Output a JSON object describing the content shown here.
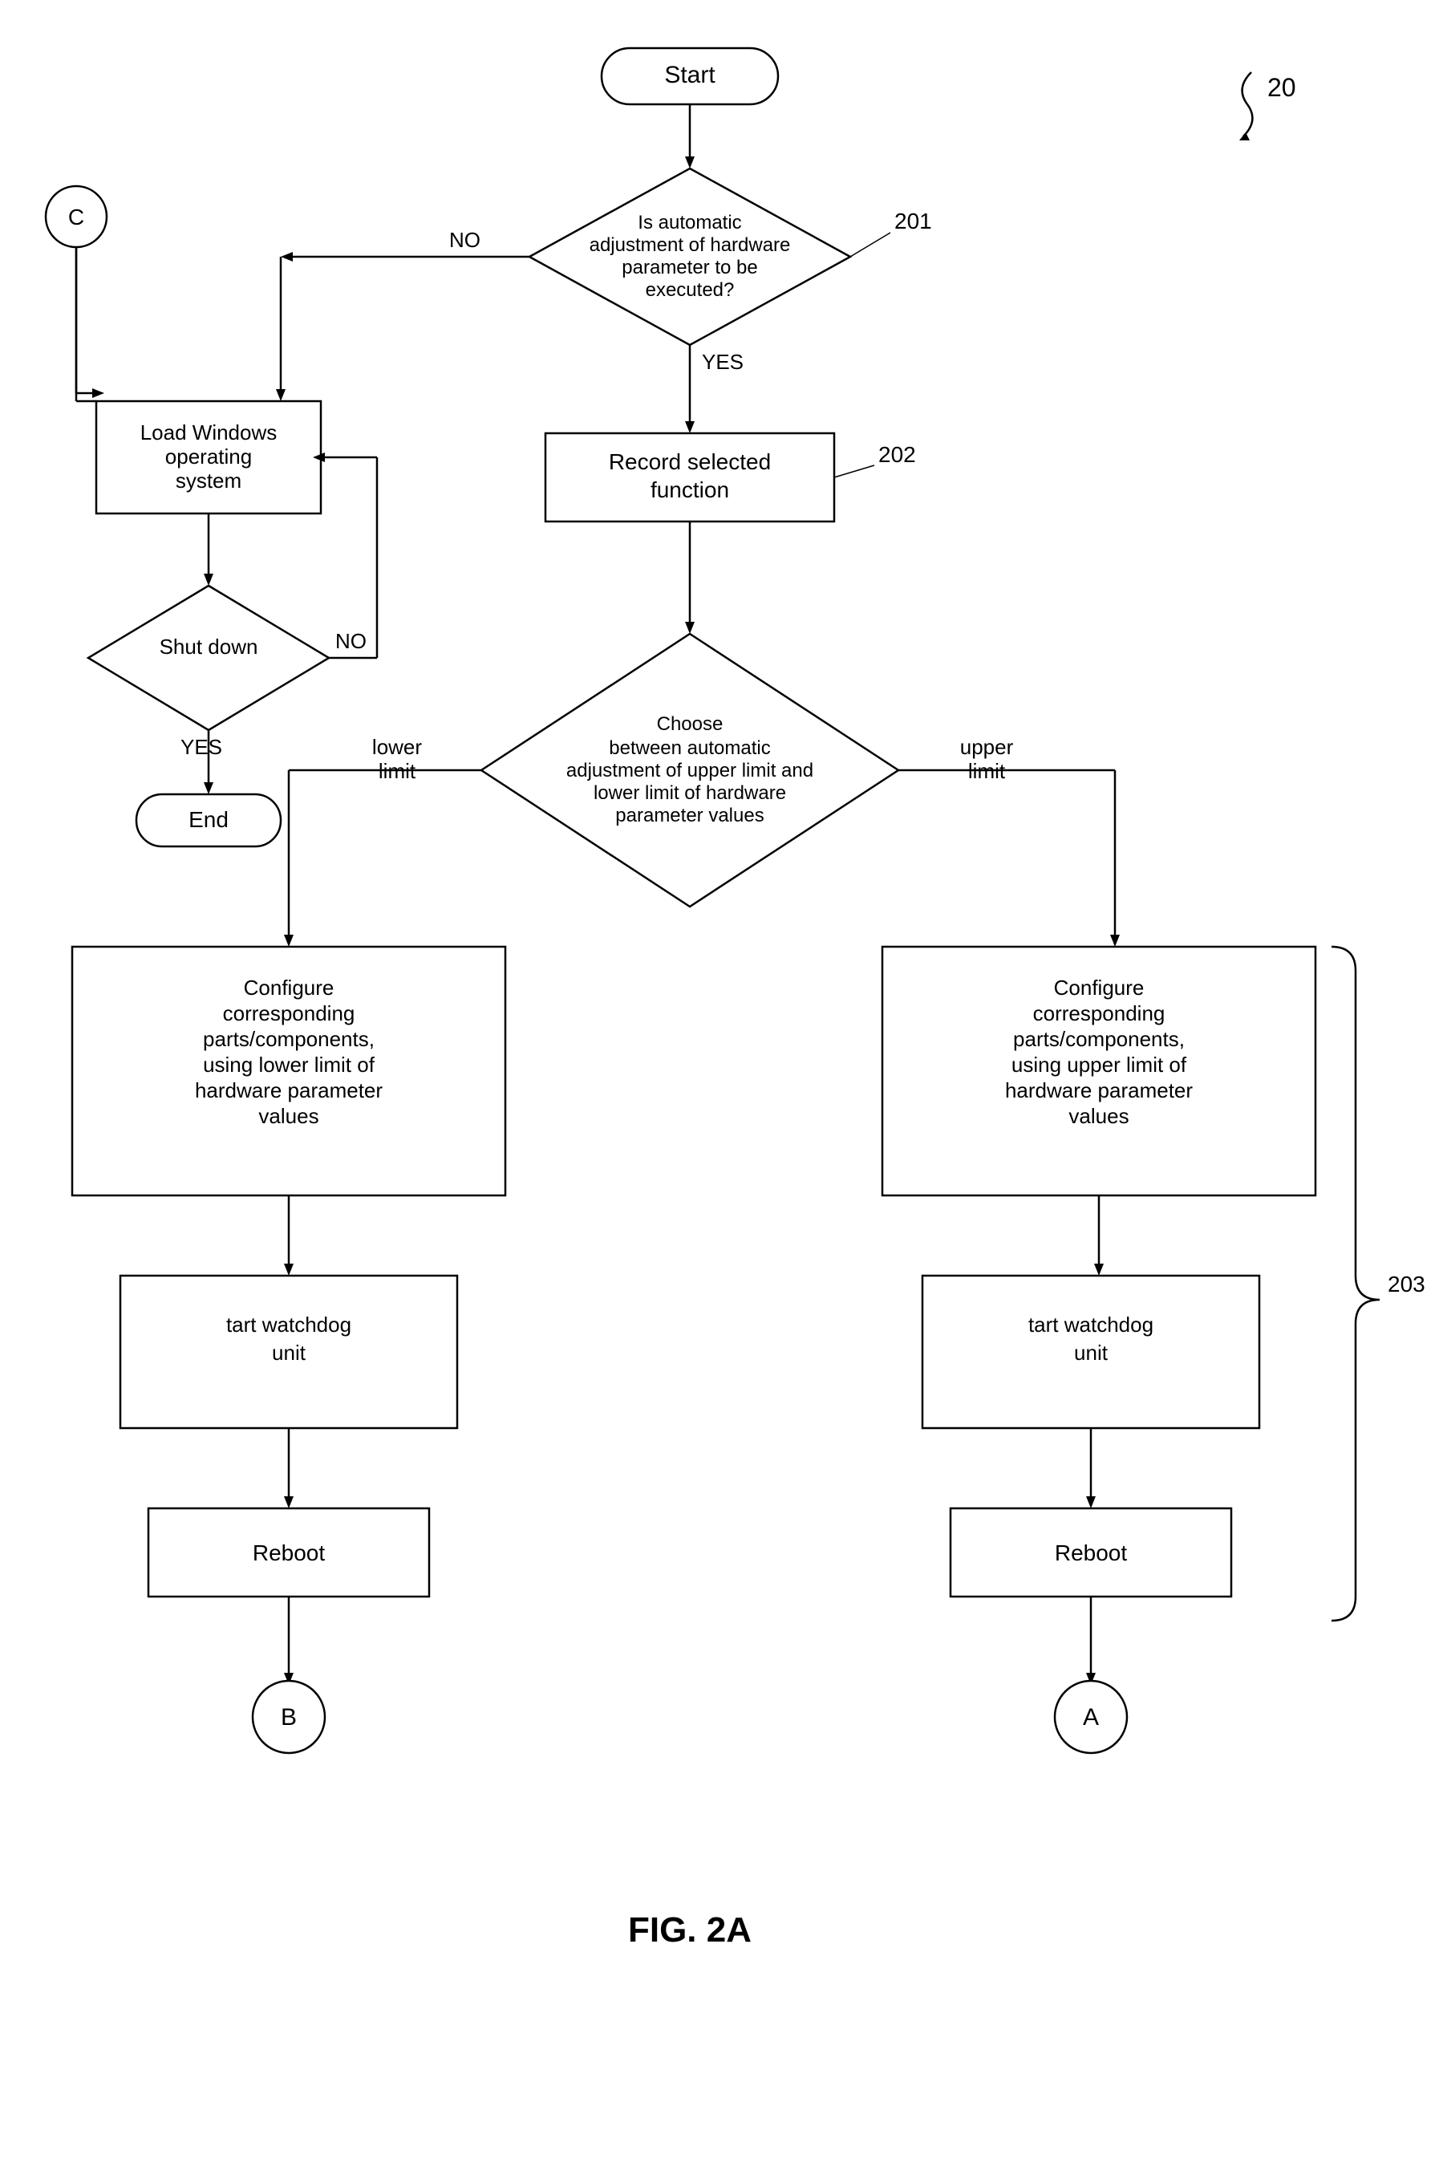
{
  "title": "FIG. 2A",
  "figure_number": "20",
  "nodes": {
    "start": {
      "label": "Start"
    },
    "decision1": {
      "label": "Is automatic\nadjustment of hardware\nparameter to be\nexecuted?",
      "ref": "201"
    },
    "record": {
      "label": "Record selected\nfunction",
      "ref": "202"
    },
    "load_windows": {
      "label": "Load Windows\noperating\nsystem"
    },
    "shutdown": {
      "label": "Shut down"
    },
    "end": {
      "label": "End"
    },
    "connector_c": {
      "label": "C"
    },
    "choose": {
      "label": "Choose\nbetween automatic\nadjustment of upper limit and\nlower limit of hardware\nparameter values"
    },
    "config_lower": {
      "label": "Configure\ncorresponding\nparts/components,\nusing lower limit of\nhardware parameter\nvalues"
    },
    "config_upper": {
      "label": "Configure\ncorresponding\nparts/components,\nusing upper limit of\nhardware parameter\nvalues"
    },
    "watchdog_left": {
      "label": "tart watchdog\nunit"
    },
    "watchdog_right": {
      "label": "tart watchdog\nunit"
    },
    "reboot_left": {
      "label": "Reboot"
    },
    "reboot_right": {
      "label": "Reboot"
    },
    "connector_b": {
      "label": "B"
    },
    "connector_a": {
      "label": "A"
    },
    "ref_203": {
      "label": "203"
    },
    "ref_20": {
      "label": "20"
    },
    "lower_limit": {
      "label": "lower\nlimit"
    },
    "upper_limit": {
      "label": "upper\nlimit"
    },
    "no_label1": {
      "label": "NO"
    },
    "yes_label1": {
      "label": "YES"
    },
    "no_label2": {
      "label": "NO"
    },
    "yes_label2": {
      "label": "YES"
    }
  },
  "colors": {
    "stroke": "#000000",
    "fill": "#ffffff",
    "text": "#000000"
  }
}
